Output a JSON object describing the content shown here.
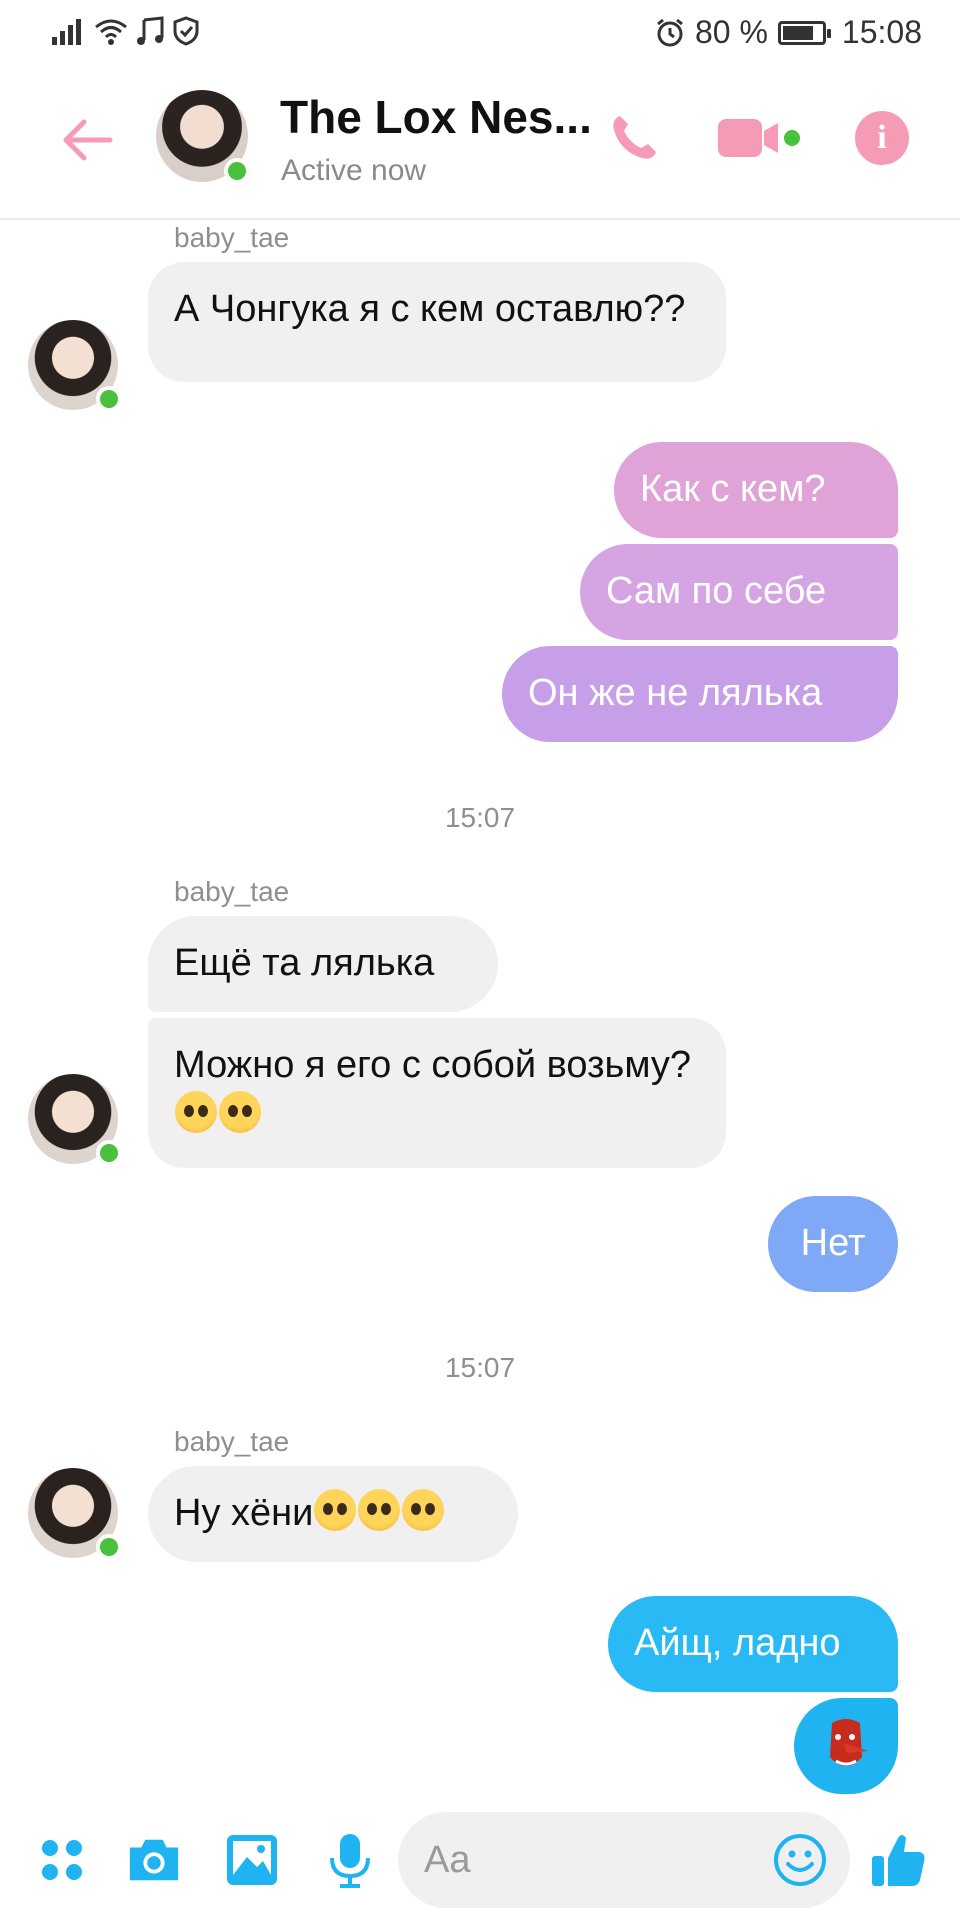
{
  "status_bar": {
    "battery_percent": "80 %",
    "battery_level": 0.8,
    "time": "15:08"
  },
  "header": {
    "title": "The Lox Nes...",
    "subtitle": "Active now",
    "accent_color": "#f59bb6"
  },
  "messages": [
    {
      "type": "sender",
      "text": "baby_tae"
    },
    {
      "type": "incoming",
      "text": "А Чонгука я с кем оставлю??"
    },
    {
      "type": "outgoing",
      "text": "Как с кем?"
    },
    {
      "type": "outgoing",
      "text": "Сам по себе"
    },
    {
      "type": "outgoing",
      "text": "Он же не лялька"
    },
    {
      "type": "timestamp",
      "text": "15:07"
    },
    {
      "type": "sender",
      "text": "baby_tae"
    },
    {
      "type": "incoming",
      "text": "Ещё та лялька"
    },
    {
      "type": "incoming",
      "text": "Можно я его с собой возьму?"
    },
    {
      "type": "outgoing",
      "text": "Нет"
    },
    {
      "type": "timestamp",
      "text": "15:07"
    },
    {
      "type": "sender",
      "text": "baby_tae"
    },
    {
      "type": "incoming",
      "text": "Ну хёни"
    },
    {
      "type": "outgoing",
      "text": "Айщ, ладно"
    }
  ],
  "emoji": {
    "pleading": "pleading-face-emoji",
    "tengu": "tengu-mask-emoji"
  },
  "composer": {
    "placeholder": "Aa"
  },
  "colors": {
    "accent_blue": "#1fb3f1",
    "incoming_bubble": "#f1f0f0",
    "online": "#48c13c"
  }
}
